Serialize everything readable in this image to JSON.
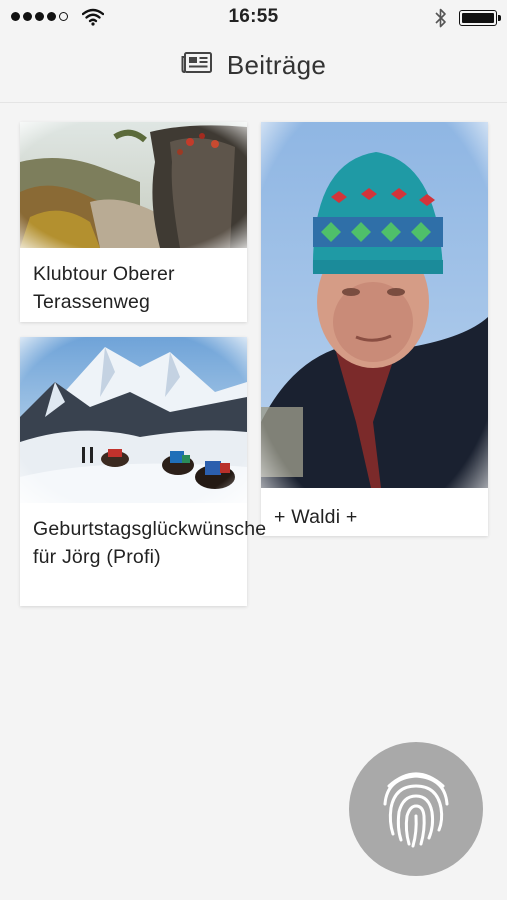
{
  "status_bar": {
    "time": "16:55",
    "signal_icon": "signal-dots-icon",
    "wifi_icon": "wifi-icon",
    "bluetooth_icon": "bluetooth-icon",
    "battery_icon": "battery-icon",
    "battery_level": 1.0
  },
  "header": {
    "icon": "newspaper-icon",
    "title": "Beiträge"
  },
  "posts": [
    {
      "title": "Klubtour Oberer Terassenweg",
      "image": "rocky-forest-trail-photo"
    },
    {
      "title": "+ Waldi +",
      "image": "man-in-knit-hat-portrait-photo"
    },
    {
      "title": "Geburtstagsglückwünsche für Jörg (Profi)",
      "image": "himalaya-yak-caravan-photo"
    }
  ],
  "fab": {
    "icon": "fingerprint-icon"
  },
  "colors": {
    "background": "#f4f4f4",
    "card": "#ffffff",
    "fab": "#a9a9a9",
    "text": "#222222"
  }
}
